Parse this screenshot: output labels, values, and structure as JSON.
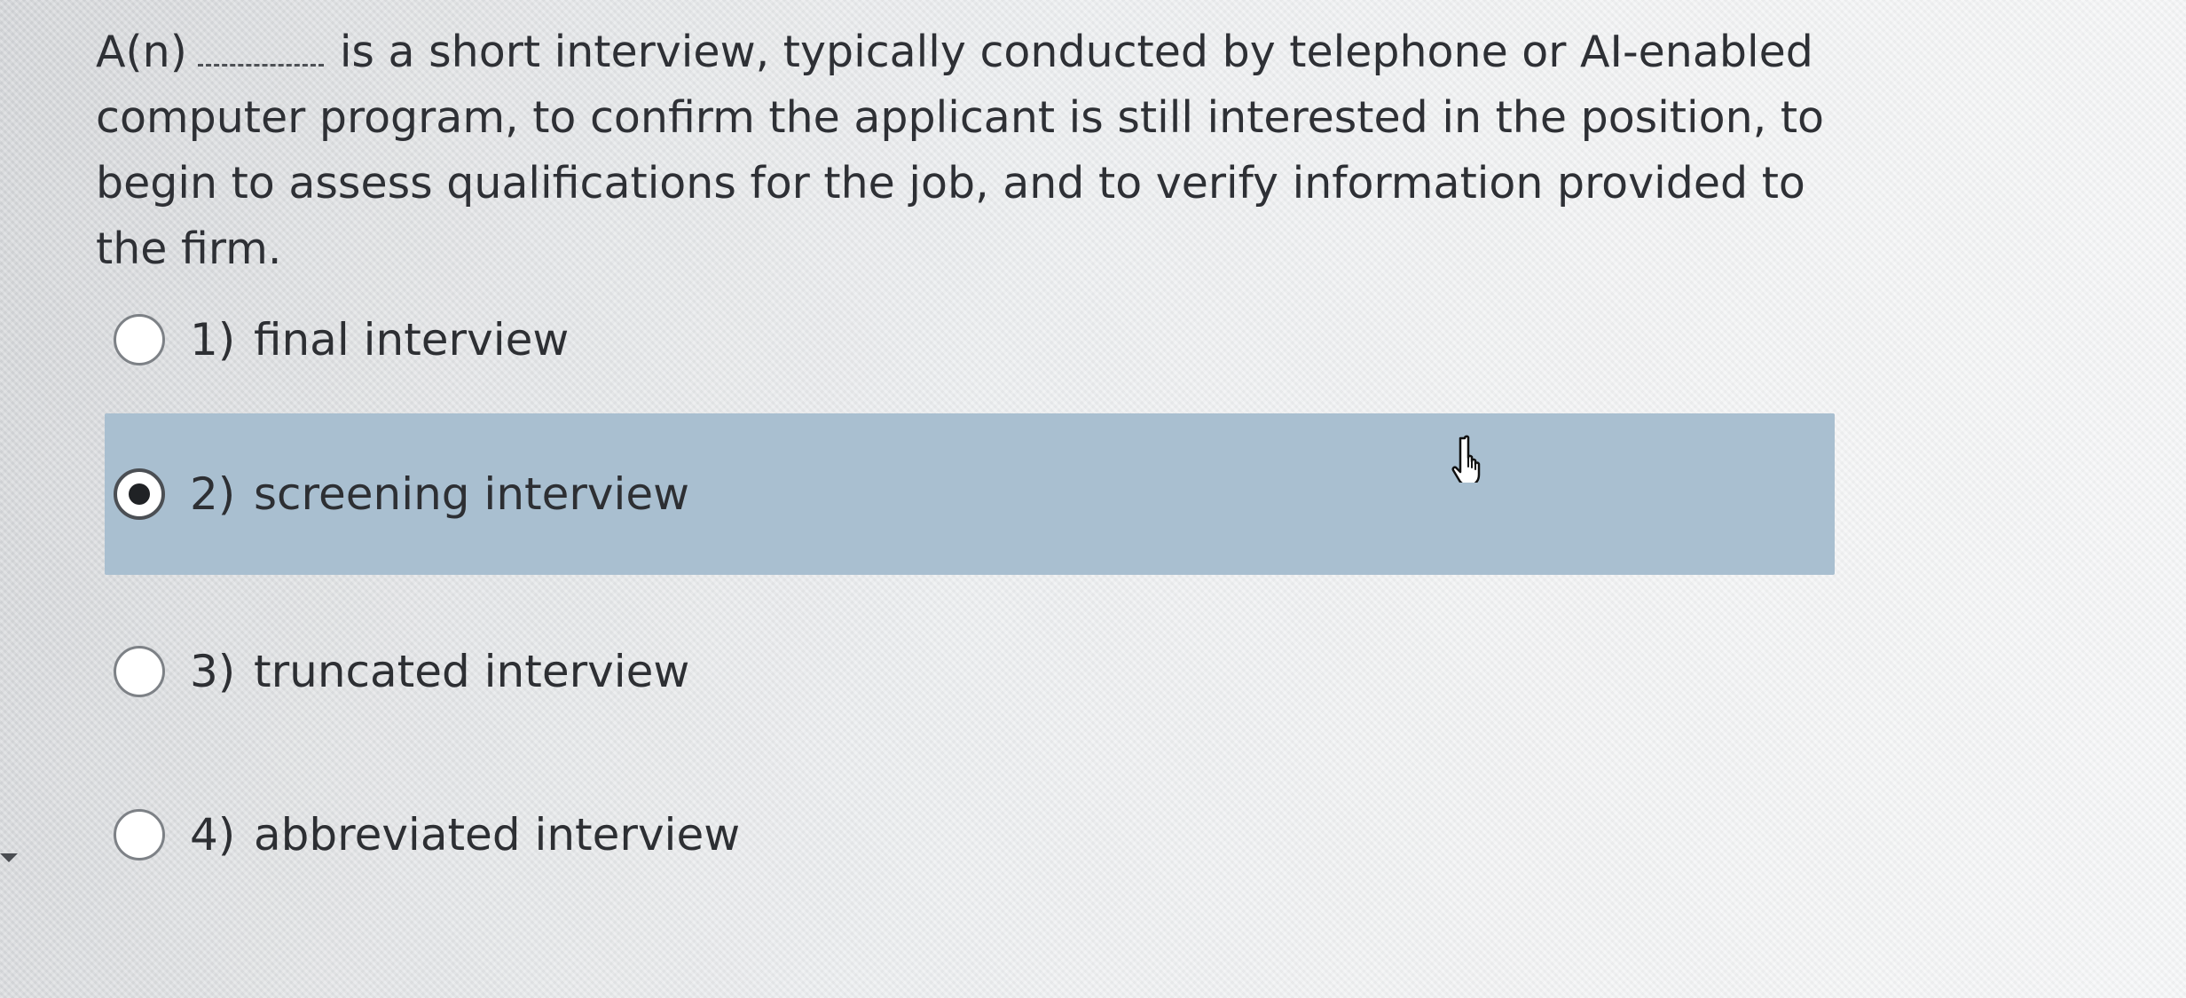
{
  "question": {
    "prefix": "A(n)",
    "body": "is a short interview, typically conducted by telephone or AI-enabled computer program, to confirm the applicant is still interested in the position, to begin to assess qualifications for the job, and to verify information provided to the firm."
  },
  "options": [
    {
      "number": "1)",
      "text": "final interview",
      "selected": false
    },
    {
      "number": "2)",
      "text": "screening interview",
      "selected": true
    },
    {
      "number": "3)",
      "text": "truncated interview",
      "selected": false
    },
    {
      "number": "4)",
      "text": "abbreviated interview",
      "selected": false
    }
  ],
  "icons": {
    "radio_selected": "radio-selected-icon",
    "radio_unselected": "radio-unselected-icon",
    "cursor": "pointer-hand-icon",
    "side_marker": "small-triangle-icon"
  },
  "colors": {
    "selected_row": "#a9bfd0",
    "text": "#2d2f33"
  }
}
